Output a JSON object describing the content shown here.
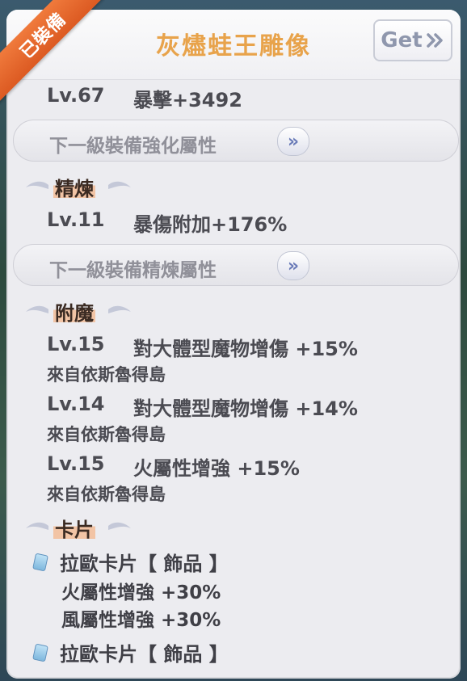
{
  "badge": "已裝備",
  "title": "灰燼蛙王雕像",
  "get_button": {
    "label": "Get",
    "icon": "double-chevron-right-icon"
  },
  "base": {
    "level": "Lv.67",
    "stat": "暴擊+3492"
  },
  "next_enhance": {
    "label": "下一級裝備強化屬性",
    "icon": "double-chevron-right-icon"
  },
  "refine": {
    "heading": "精煉",
    "level": "Lv.11",
    "stat": "暴傷附加+176%"
  },
  "next_refine": {
    "label": "下一級裝備精煉屬性",
    "icon": "double-chevron-right-icon"
  },
  "enchant": {
    "heading": "附魔",
    "items": [
      {
        "level": "Lv.15",
        "stat": "對大體型魔物增傷 +15%",
        "source": "來自依斯魯得島"
      },
      {
        "level": "Lv.14",
        "stat": "對大體型魔物增傷 +14%",
        "source": "來自依斯魯得島"
      },
      {
        "level": "Lv.15",
        "stat": "火屬性增強 +15%",
        "source": "來自依斯魯得島"
      }
    ]
  },
  "cards": {
    "heading": "卡片",
    "items": [
      {
        "name": "拉歐卡片【 飾品 】",
        "stats": [
          "火屬性增強 +30%",
          "風屬性增強 +30%"
        ]
      },
      {
        "name": "拉歐卡片【 飾品 】",
        "stats": []
      }
    ]
  },
  "colors": {
    "title": "#e8a34b",
    "badge": "#e2642b",
    "section_highlight": "#f2c4a5"
  }
}
